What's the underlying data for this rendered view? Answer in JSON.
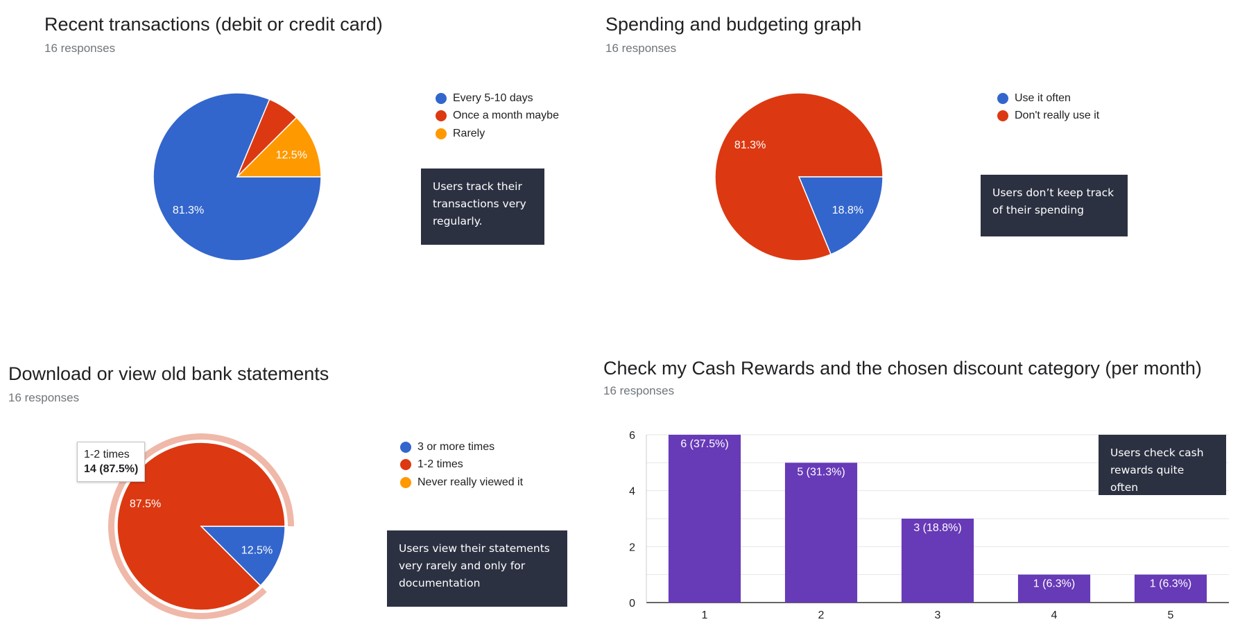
{
  "chart_data": [
    {
      "type": "pie",
      "title": "Recent transactions (debit or credit card)",
      "subtitle": "16 responses",
      "categories": [
        "Every 5-10 days",
        "Once a month maybe",
        "Rarely"
      ],
      "values": [
        81.3,
        6.2,
        12.5
      ],
      "data_labels": [
        "81.3%",
        "",
        "12.5%"
      ],
      "colors": [
        "#3366cc",
        "#dc3912",
        "#ff9900"
      ],
      "legend": "right",
      "note": "Users track their transactions very regularly."
    },
    {
      "type": "pie",
      "title": "Spending and budgeting graph",
      "subtitle": "16 responses",
      "categories": [
        "Use it often",
        "Don't really use it"
      ],
      "values": [
        18.8,
        81.3
      ],
      "data_labels": [
        "18.8%",
        "81.3%"
      ],
      "colors": [
        "#3366cc",
        "#dc3912"
      ],
      "legend": "right",
      "note": "Users don’t keep track of their spending"
    },
    {
      "type": "pie",
      "title": "Download or view old bank statements",
      "subtitle": "16 responses",
      "categories": [
        "3 or more times",
        "1-2 times",
        "Never really viewed it"
      ],
      "values": [
        12.5,
        87.5,
        0
      ],
      "data_labels": [
        "12.5%",
        "87.5%",
        ""
      ],
      "colors": [
        "#3366cc",
        "#dc3912",
        "#ff9900"
      ],
      "legend": "right",
      "highlighted": "1-2 times",
      "tooltip": {
        "label": "1-2 times",
        "value": "14 (87.5%)"
      },
      "note": "Users view their statements very rarely and only for documentation"
    },
    {
      "type": "bar",
      "title": "Check my Cash Rewards and the chosen discount category (per month)",
      "subtitle": "16 responses",
      "categories": [
        "1",
        "2",
        "3",
        "4",
        "5"
      ],
      "values": [
        6,
        5,
        3,
        1,
        1
      ],
      "data_labels": [
        "6 (37.5%)",
        "5 (31.3%)",
        "3 (18.8%)",
        "1 (6.3%)",
        "1 (6.3%)"
      ],
      "yticks": [
        "0",
        "2",
        "4",
        "6"
      ],
      "ylim": [
        0,
        6
      ],
      "grid": true,
      "color": "#673ab7",
      "note": "Users check cash rewards quite often"
    }
  ]
}
